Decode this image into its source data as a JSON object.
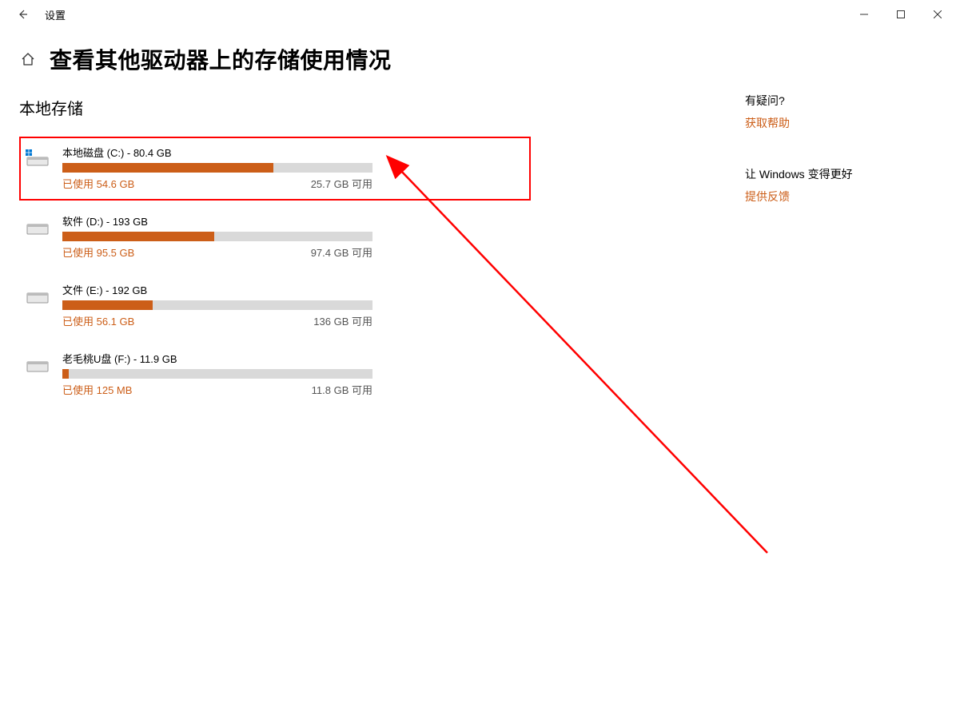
{
  "window": {
    "app_title": "设置"
  },
  "page": {
    "title": "查看其他驱动器上的存储使用情况",
    "section_heading": "本地存储"
  },
  "drives": [
    {
      "label": "本地磁盘 (C:) - 80.4 GB",
      "used": "已使用 54.6 GB",
      "free": "25.7 GB 可用",
      "fill_pct": 68,
      "highlight": true,
      "system": true
    },
    {
      "label": "软件 (D:) - 193 GB",
      "used": "已使用 95.5 GB",
      "free": "97.4 GB 可用",
      "fill_pct": 49,
      "highlight": false,
      "system": false
    },
    {
      "label": "文件 (E:) - 192 GB",
      "used": "已使用 56.1 GB",
      "free": "136 GB 可用",
      "fill_pct": 29,
      "highlight": false,
      "system": false
    },
    {
      "label": "老毛桃U盘 (F:) - 11.9 GB",
      "used": "已使用 125 MB",
      "free": "11.8 GB 可用",
      "fill_pct": 2,
      "highlight": false,
      "system": false
    }
  ],
  "help": {
    "question_heading": "有疑问?",
    "get_help": "获取帮助",
    "make_better_heading": "让 Windows 变得更好",
    "feedback": "提供反馈"
  },
  "colors": {
    "accent": "#cc5e18",
    "bar_bg": "#d9d9d9",
    "annotation_red": "#f00"
  }
}
